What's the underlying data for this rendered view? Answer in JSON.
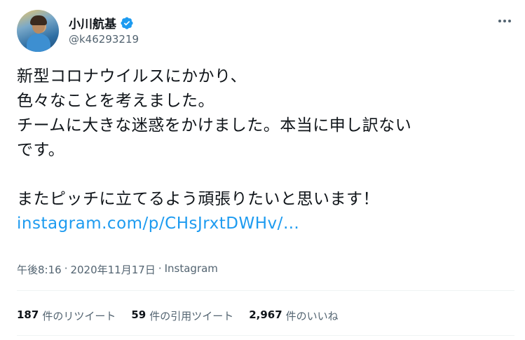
{
  "header": {
    "display_name": "小川航基",
    "handle": "@k46293219",
    "verified": true
  },
  "tweet": {
    "lines": [
      "新型コロナウイルスにかかり、",
      "色々なことを考えました。",
      "チームに大きな迷惑をかけました。本当に申し訳ない",
      "です。",
      "",
      "またピッチに立てるよう頑張りたいと思います！"
    ],
    "link": "instagram.com/p/CHsJrxtDWHv/…"
  },
  "meta": {
    "time": "午後8:16",
    "sep1": "·",
    "date": "2020年11月17日",
    "sep2": "·",
    "source": "Instagram"
  },
  "stats": {
    "retweets_count": "187",
    "retweets_label": "件のリツイート",
    "quotes_count": "59",
    "quotes_label": "件の引用ツイート",
    "likes_count": "2,967",
    "likes_label": "件のいいね"
  },
  "colors": {
    "link": "#1d9bf0",
    "verified": "#1d9bf0",
    "secondary_text": "#536471"
  }
}
